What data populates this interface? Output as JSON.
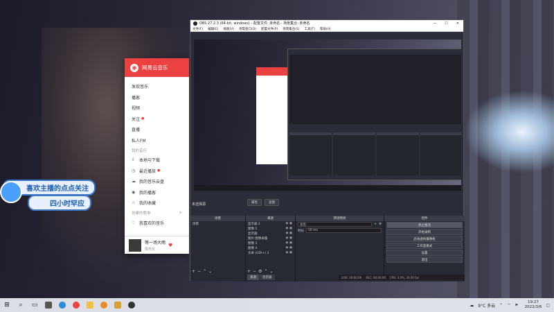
{
  "music": {
    "app_name": "网易云音乐",
    "nav": [
      {
        "label": "发现音乐"
      },
      {
        "label": "播客"
      },
      {
        "label": "视频"
      },
      {
        "label": "关注",
        "dot": true
      },
      {
        "label": "直播"
      },
      {
        "label": "私人FM"
      }
    ],
    "section_my": "我的音乐",
    "my_items": [
      {
        "icon": "⇩",
        "label": "本地与下载"
      },
      {
        "icon": "◷",
        "label": "最近播放",
        "dot": true
      },
      {
        "icon": "☁",
        "label": "我的音乐云盘"
      },
      {
        "icon": "◉",
        "label": "我的播客"
      },
      {
        "icon": "☆",
        "label": "我的收藏"
      }
    ],
    "section_playlist": "创建的歌单",
    "playlist_add": "+",
    "favorite": "我喜欢的音乐",
    "player": {
      "song": "等一场大雨",
      "artist": "周杰伦"
    }
  },
  "banner": {
    "line1": "喜欢主播的点点关注",
    "line2": "四小时罕应"
  },
  "obs": {
    "title": "OBS 27.2.3 (64-bit, windows) - 配置文件: 未命名 - 场景集合: 未命名",
    "menu": [
      "文件(F)",
      "编辑(E)",
      "视图(V)",
      "停靠窗口(D)",
      "配置文件(P)",
      "场景集合(S)",
      "工具(T)",
      "帮助(H)"
    ],
    "no_source": "未选择源",
    "top_buttons": [
      "属性",
      "滤镜"
    ],
    "docks": {
      "scenes": {
        "title": "场景",
        "items": [
          "场景"
        ]
      },
      "sources": {
        "title": "来源",
        "items": [
          "显示器 2",
          "图像 5",
          "显示器",
          "图片·图像采集",
          "图像 3",
          "图像 4",
          "文本 (GDI+) 3"
        ]
      },
      "mixer": {
        "title": "转场特效",
        "transition": "淡出",
        "duration_label": "时长",
        "duration": "50 ms"
      },
      "controls": {
        "title": "控件",
        "buttons": [
          "停止推流",
          "开始录制",
          "启动虚拟摄像机",
          "工作室模式",
          "设置",
          "退出"
        ]
      }
    },
    "source_tabs": [
      "来源",
      "混音器"
    ],
    "status": [
      "LIVE: 00:00:00",
      "REC: 00:00:00",
      "CPU: 3.0%, 30.00 fps"
    ]
  },
  "taskbar": {
    "weather": "9°C 多云",
    "time": "19:27",
    "date": "2022/3/6"
  },
  "colors": {
    "music_red": "#ec4141",
    "obs_bg": "#2b2e38"
  }
}
